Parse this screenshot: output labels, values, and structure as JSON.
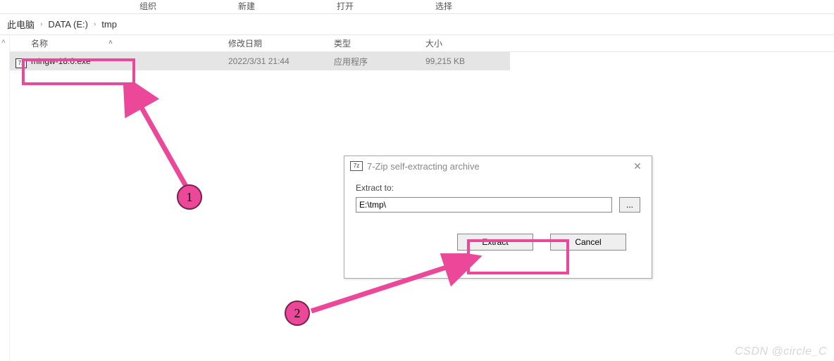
{
  "ribbon": {
    "tabs": [
      "组织",
      "新建",
      "打开",
      "选择"
    ]
  },
  "breadcrumb": {
    "parts": [
      "此电脑",
      "DATA (E:)",
      "tmp"
    ]
  },
  "columns": {
    "name": "名称",
    "date": "修改日期",
    "type": "类型",
    "size": "大小"
  },
  "file": {
    "icon_glyph": "7z",
    "name": "mingw-18.0.exe",
    "date": "2022/3/31 21:44",
    "type": "应用程序",
    "size": "99,215 KB"
  },
  "dialog": {
    "icon_glyph": "7z",
    "title": "7-Zip self-extracting archive",
    "extract_to_label": "Extract to:",
    "path": "E:\\tmp\\",
    "browse_label": "...",
    "extract_btn": "Extract",
    "cancel_btn": "Cancel"
  },
  "annotations": {
    "num1": "1",
    "num2": "2"
  },
  "watermark": "CSDN @circle_C"
}
